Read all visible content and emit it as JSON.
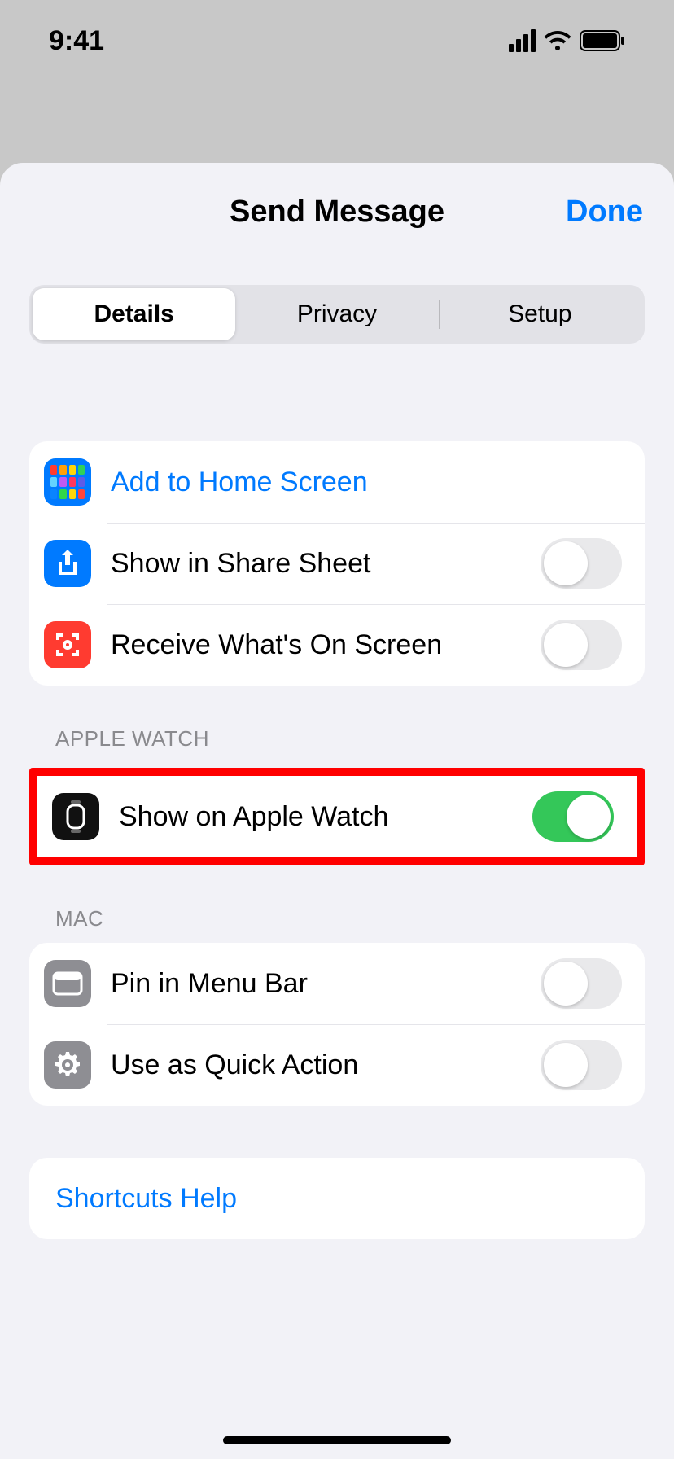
{
  "statusbar": {
    "time": "9:41"
  },
  "sheet": {
    "title": "Send Message",
    "done": "Done",
    "tabs": [
      "Details",
      "Privacy",
      "Setup"
    ],
    "selected_tab": 0
  },
  "group1": {
    "add_home": "Add to Home Screen",
    "share_sheet": "Show in Share Sheet",
    "receive_screen": "Receive What's On Screen",
    "share_sheet_on": false,
    "receive_screen_on": false
  },
  "apple_watch": {
    "header": "APPLE WATCH",
    "label": "Show on Apple Watch",
    "on": true
  },
  "mac": {
    "header": "MAC",
    "pin_menu": "Pin in Menu Bar",
    "pin_menu_on": false,
    "quick_action": "Use as Quick Action",
    "quick_action_on": false
  },
  "help": {
    "label": "Shortcuts Help"
  }
}
